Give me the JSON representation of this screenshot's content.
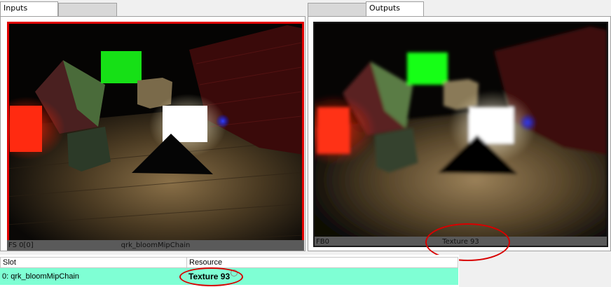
{
  "inputs_tabs": [
    {
      "label": "Inputs",
      "active": true
    },
    {
      "label": "",
      "active": false
    }
  ],
  "outputs_tabs": [
    {
      "label": "",
      "active": false
    },
    {
      "label": "Outputs",
      "active": true
    }
  ],
  "input_preview": {
    "slot_label": "FS 0[0]",
    "resource_name": "qrk_bloomMipChain"
  },
  "output_preview": {
    "slot_label": "FB0",
    "resource_name": "Texture 93"
  },
  "table": {
    "columns": [
      "Slot",
      "Resource"
    ],
    "rows": [
      {
        "slot": "0: qrk_bloomMipChain",
        "resource": "Texture 93"
      }
    ]
  },
  "colors": {
    "selection_outline": "#e10000",
    "annotation_ellipse": "#d80000",
    "row_highlight": "#7fffd4"
  },
  "icons": {
    "resource_link": "link-icon"
  }
}
